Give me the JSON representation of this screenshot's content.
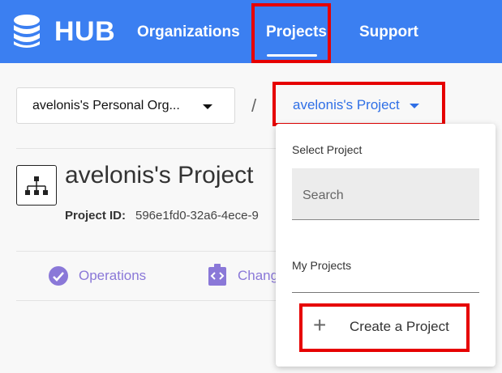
{
  "header": {
    "logo_text": "HUB",
    "nav": [
      {
        "label": "Organizations"
      },
      {
        "label": "Projects"
      },
      {
        "label": "Support"
      }
    ]
  },
  "breadcrumb": {
    "org_label": "avelonis's Personal Org...",
    "separator": "/",
    "project_label": "avelonis's Project"
  },
  "project": {
    "title": "avelonis's Project",
    "id_label": "Project ID:",
    "id_value": "596e1fd0-32a6-4ece-9"
  },
  "tabs": [
    {
      "label": "Operations"
    },
    {
      "label": "Changes"
    }
  ],
  "dropdown": {
    "heading": "Select Project",
    "search_placeholder": "Search",
    "my_projects_label": "My Projects",
    "create_icon": "plus-icon",
    "create_label": "Create a Project"
  },
  "colors": {
    "header_bg": "#3b7ff1",
    "accent_blue": "#2f6fe6",
    "tab_purple": "#8a78d8",
    "highlight_red": "#e60000"
  }
}
